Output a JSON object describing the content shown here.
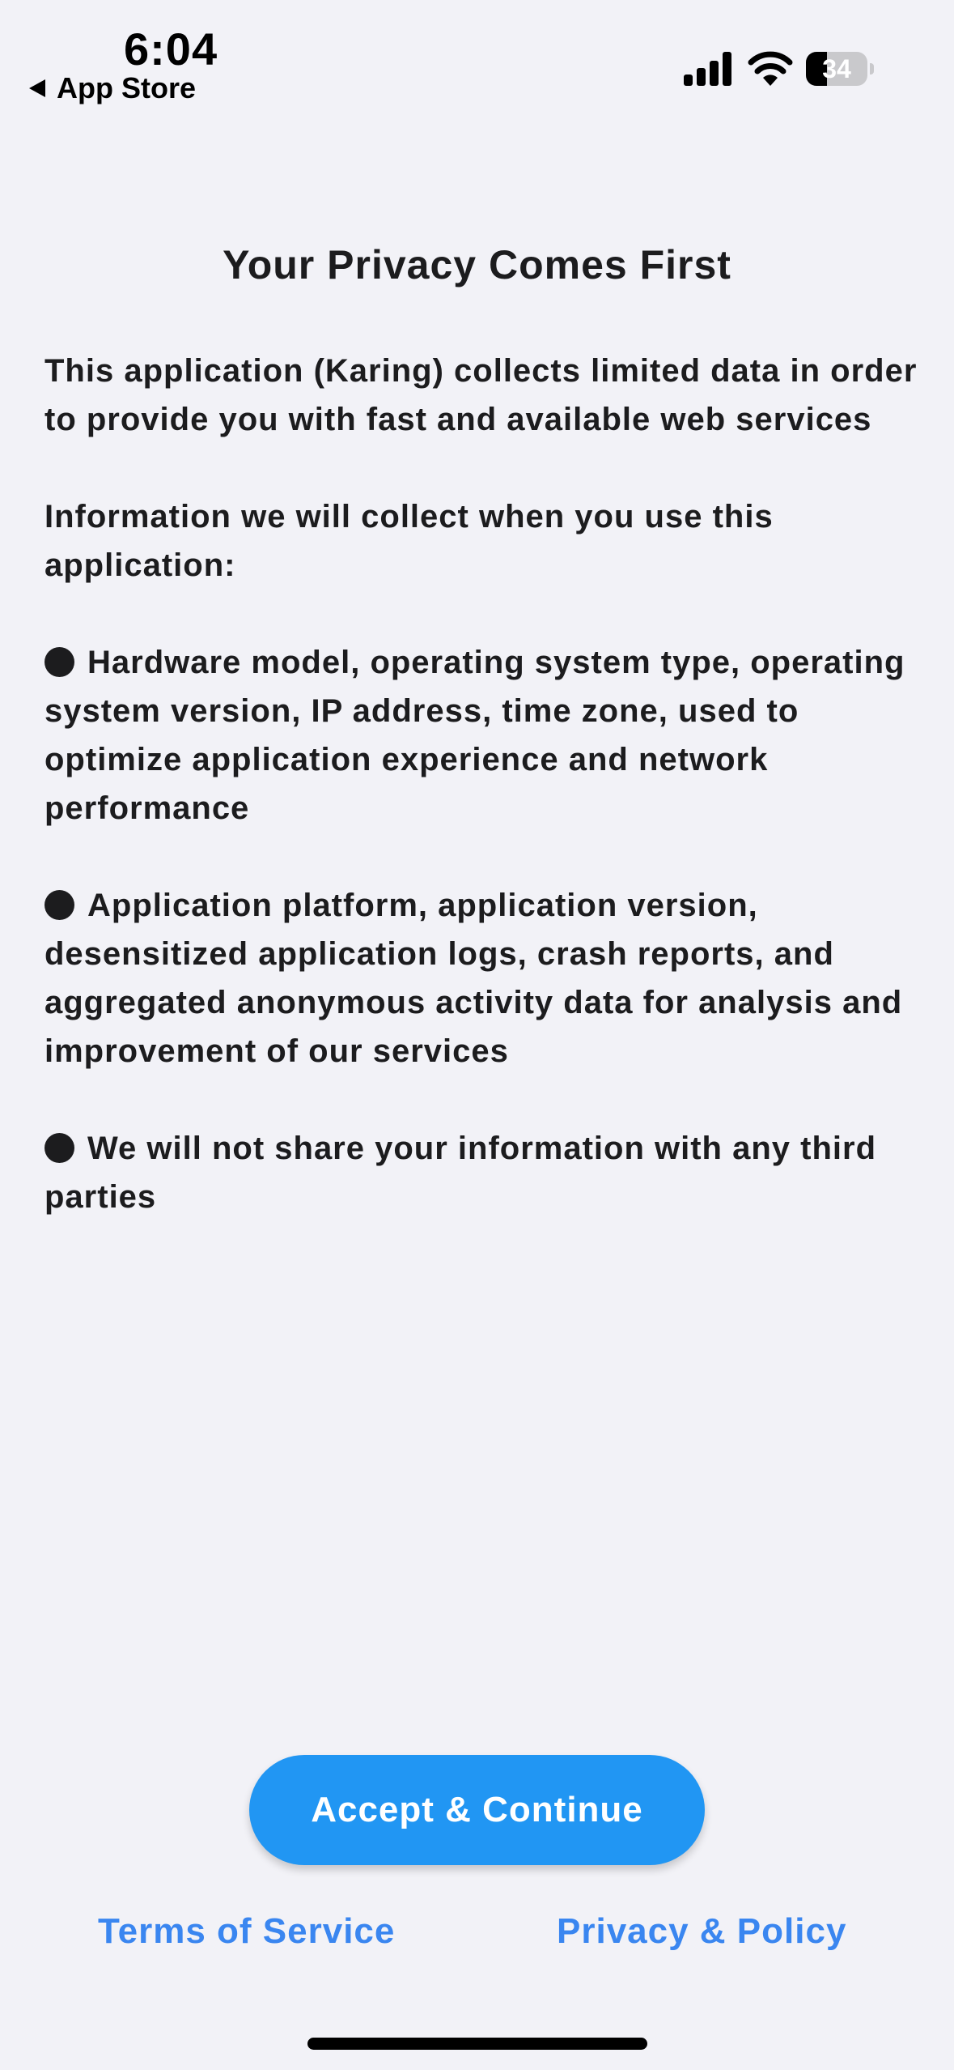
{
  "status_bar": {
    "time": "6:04",
    "back_label": "App Store",
    "battery_level": "34",
    "battery_fraction": 0.34,
    "icons": [
      "signal-icon",
      "wifi-icon",
      "battery-icon"
    ]
  },
  "title": "Your Privacy Comes First",
  "paragraphs": {
    "intro": "This application (Karing) collects limited data in order to provide you with fast and available web services",
    "collect_heading": "Information we will collect when you use this application:",
    "bullet_1": "Hardware model, operating system type, operating system version, IP address, time zone, used to optimize application experience and network performance",
    "bullet_2": "Application platform, application version, desensitized application logs, crash reports, and aggregated anonymous activity data for analysis and improvement of our services",
    "bullet_3": "We will not share your information with any third parties"
  },
  "accept_button": "Accept & Continue",
  "footer": {
    "terms_label": "Terms of Service",
    "privacy_label": "Privacy & Policy"
  },
  "colors": {
    "accent": "#2196f3",
    "link": "#3a86f0",
    "background": "#f2f2f7",
    "text": "#1c1c1e"
  }
}
